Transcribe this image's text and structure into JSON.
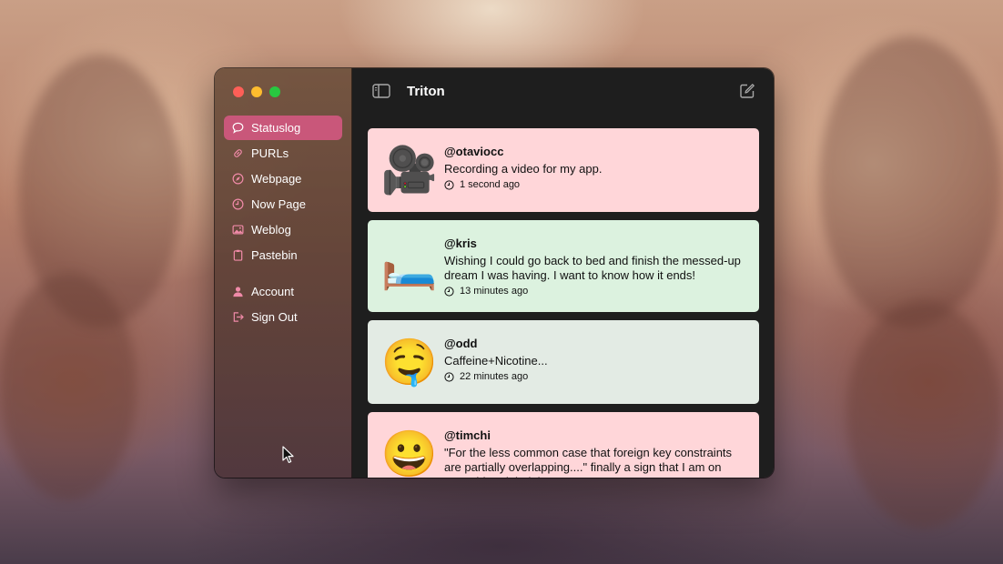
{
  "window": {
    "title": "Triton"
  },
  "sidebar": {
    "items": [
      {
        "label": "Statuslog",
        "icon": "speech-bubble-icon",
        "active": true
      },
      {
        "label": "PURLs",
        "icon": "link-icon",
        "active": false
      },
      {
        "label": "Webpage",
        "icon": "compass-icon",
        "active": false
      },
      {
        "label": "Now Page",
        "icon": "clock-icon",
        "active": false
      },
      {
        "label": "Weblog",
        "icon": "photo-icon",
        "active": false
      },
      {
        "label": "Pastebin",
        "icon": "clipboard-icon",
        "active": false
      }
    ],
    "account_items": [
      {
        "label": "Account",
        "icon": "person-icon"
      },
      {
        "label": "Sign Out",
        "icon": "sign-out-icon"
      }
    ]
  },
  "feed": {
    "posts": [
      {
        "emoji": "🎥",
        "handle": "@otaviocc",
        "status": "Recording a video for my app.",
        "time": "1 second ago",
        "color": "#ffd6d9"
      },
      {
        "emoji": "🛏️",
        "handle": "@kris",
        "status": "Wishing I could go back to bed and finish the messed-up dream I was having.  I want to know how it ends!",
        "time": "13 minutes ago",
        "color": "#dcf2df"
      },
      {
        "emoji": "🤤",
        "handle": "@odd",
        "status": "Caffeine+Nicotine...",
        "time": "22 minutes ago",
        "color": "#e3ebe4"
      },
      {
        "emoji": "😀",
        "handle": "@timchi",
        "status": "\"For the less common case that foreign key constraints are partially overlapping....\" finally a sign that I am on something right lol",
        "time": "",
        "color": "#ffd6d9"
      }
    ]
  },
  "colors": {
    "accent": "#c9577a",
    "icon_pink": "#f08aa8",
    "main_bg": "#1e1e1e"
  }
}
